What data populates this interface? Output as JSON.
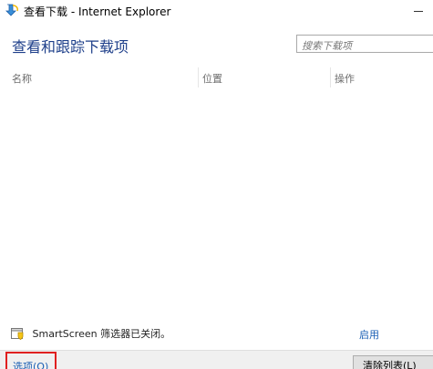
{
  "window": {
    "title": "查看下载 - Internet Explorer"
  },
  "header": {
    "title": "查看和跟踪下载项",
    "search_placeholder": "搜索下载项"
  },
  "columns": {
    "name": "名称",
    "location": "位置",
    "actions": "操作"
  },
  "smartscreen": {
    "status_text": "SmartScreen 筛选器已关闭。",
    "enable_label": "启用"
  },
  "footer": {
    "options_label": "选项(O)",
    "clear_label": "清除列表(L)"
  },
  "colors": {
    "header_title": "#1e3f8a",
    "link": "#1a5fb4",
    "highlight_border": "#e02020",
    "footer_bg": "#f0f0f0"
  },
  "icons": {
    "app": "ie-download-icon",
    "shield": "smartscreen-shield-icon"
  }
}
